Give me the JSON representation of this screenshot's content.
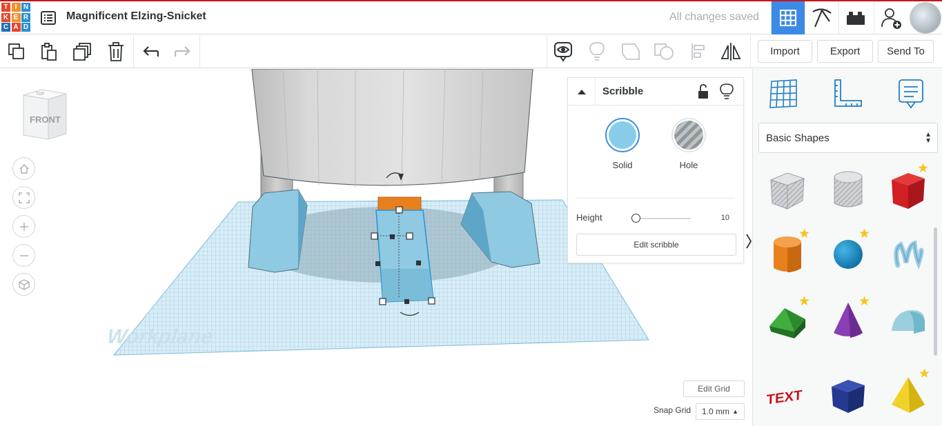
{
  "app": {
    "logo_letters": [
      "T",
      "I",
      "N",
      "K",
      "E",
      "R",
      "C",
      "A",
      "D"
    ],
    "logo_colors": [
      "#e8462a",
      "#f0912b",
      "#2a8ed4",
      "#e8462a",
      "#f0912b",
      "#2a8ed4",
      "#1f6fb5",
      "#e8462a",
      "#2a8ed4"
    ],
    "project_title": "Magnificent Elzing-Snicket",
    "save_status": "All changes saved"
  },
  "topnav": {
    "items": [
      {
        "name": "3d-design-view",
        "icon": "grid-icon",
        "active": true
      },
      {
        "name": "codeblocks-view",
        "icon": "pickaxe-icon",
        "active": false
      },
      {
        "name": "bricks-view",
        "icon": "bricks-icon",
        "active": false
      },
      {
        "name": "invite-user",
        "icon": "add-user-icon",
        "active": false
      }
    ],
    "accent": "#3d8ae6"
  },
  "toolbar": {
    "import_label": "Import",
    "export_label": "Export",
    "sendto_label": "Send To"
  },
  "workspace": {
    "viewcube_label": "FRONT",
    "viewcube_top_label": "TOP",
    "workplane_label": "Workplane",
    "edit_grid_label": "Edit Grid",
    "snap_grid_label": "Snap Grid",
    "snap_grid_value": "1.0 mm"
  },
  "inspector": {
    "title": "Scribble",
    "solid_label": "Solid",
    "hole_label": "Hole",
    "solid_color": "#87cde9",
    "height_label": "Height",
    "height_value": "10",
    "height_fraction": 0.0,
    "edit_label": "Edit scribble"
  },
  "library": {
    "category": "Basic Shapes",
    "shapes": [
      {
        "name": "box-hole",
        "star": false
      },
      {
        "name": "cylinder-hole",
        "star": false
      },
      {
        "name": "box",
        "star": true
      },
      {
        "name": "cylinder",
        "star": true
      },
      {
        "name": "sphere",
        "star": true
      },
      {
        "name": "scribble",
        "star": false
      },
      {
        "name": "roof",
        "star": true
      },
      {
        "name": "cone",
        "star": true
      },
      {
        "name": "round-roof",
        "star": false
      },
      {
        "name": "text",
        "star": false
      },
      {
        "name": "wedge",
        "star": false
      },
      {
        "name": "pyramid",
        "star": true
      }
    ]
  }
}
